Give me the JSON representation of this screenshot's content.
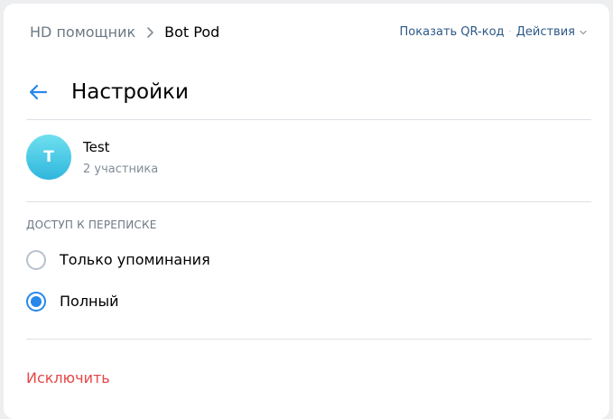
{
  "breadcrumb": {
    "parent": "HD помощник",
    "current": "Bot Pod"
  },
  "top_actions": {
    "show_qr": "Показать QR-код",
    "separator": "·",
    "actions": "Действия"
  },
  "header": {
    "title": "Настройки"
  },
  "chat": {
    "avatar_letter": "T",
    "name": "Test",
    "members": "2 участника"
  },
  "access": {
    "section_title": "ДОСТУП К ПЕРЕПИСКЕ",
    "options": [
      {
        "label": "Только упоминания",
        "selected": false
      },
      {
        "label": "Полный",
        "selected": true
      }
    ]
  },
  "kick_label": "Исключить",
  "colors": {
    "accent": "#2688eb",
    "danger": "#e64646",
    "link": "#2c5987"
  },
  "icons": {
    "back": "arrow-left-icon",
    "breadcrumb_separator": "chevron-right-icon",
    "actions_dropdown": "chevron-down-icon"
  }
}
